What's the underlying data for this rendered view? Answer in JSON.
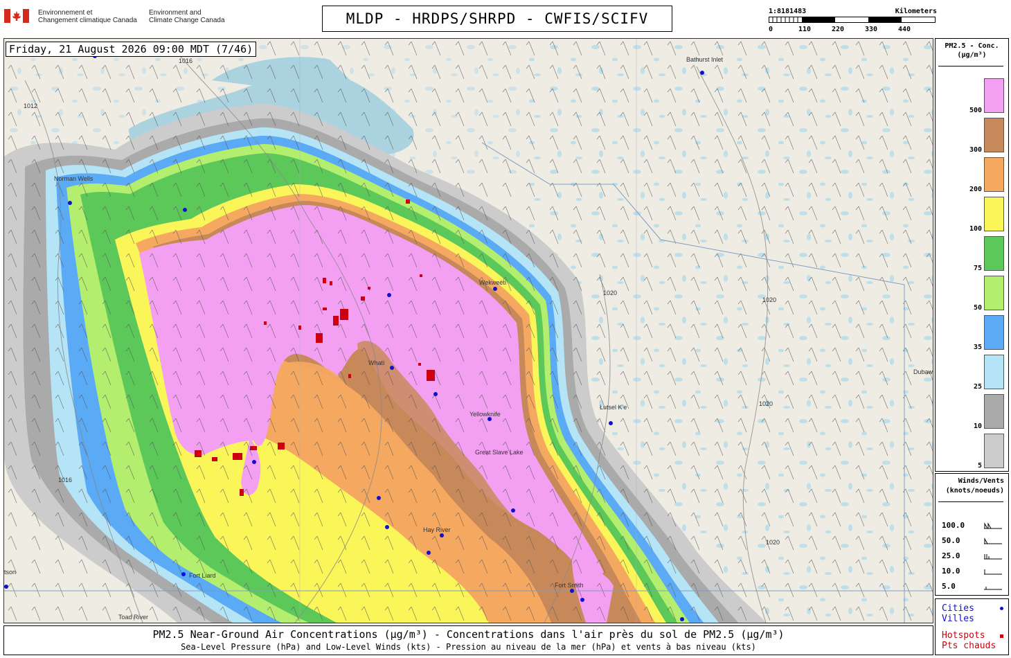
{
  "agency": {
    "fr_line1": "Environnement et",
    "fr_line2": "Changement climatique Canada",
    "en_line1": "Environment and",
    "en_line2": "Climate Change Canada"
  },
  "title": "MLDP - HRDPS/SHRPD - CWFIS/SCIFV",
  "scale": {
    "ratio": "1:8181483",
    "unit": "Kilometers",
    "ticks": [
      "0",
      "110",
      "220",
      "330",
      "440"
    ]
  },
  "timestamp": "Friday, 21 August 2026 09:00 MDT (7/46)",
  "legend": {
    "title_line1": "PM2.5 - Conc.",
    "title_line2": "(µg/m³)",
    "bins": [
      {
        "label": "500",
        "color": "#f3a0f3"
      },
      {
        "label": "300",
        "color": "#c8895a"
      },
      {
        "label": "200",
        "color": "#f5a860"
      },
      {
        "label": "100",
        "color": "#faf65a"
      },
      {
        "label": "75",
        "color": "#5cc85a"
      },
      {
        "label": "50",
        "color": "#b4ee6e"
      },
      {
        "label": "35",
        "color": "#5aaaf5"
      },
      {
        "label": "25",
        "color": "#b4e4f5"
      },
      {
        "label": "10",
        "color": "#aaaaaa"
      },
      {
        "label": "5",
        "color": "#cccccc"
      }
    ]
  },
  "winds_legend": {
    "title_line1": "Winds/Vents",
    "title_line2": "(knots/noeuds)",
    "entries": [
      "100.0",
      "50.0",
      "25.0",
      "10.0",
      "5.0"
    ]
  },
  "key": {
    "cities_line1": "Cities",
    "cities_line2": "Villes",
    "hotspots_line1": "Hotspots",
    "hotspots_line2": "Pts chauds",
    "city_color": "#1010d0",
    "hotspot_color": "#cc0010"
  },
  "footer": {
    "line1": "PM2.5 Near-Ground Air Concentrations (µg/m³) - Concentrations dans l'air près du sol de PM2.5 (µg/m³)",
    "line2": "Sea-Level Pressure (hPa) and Low-Level Winds (kts) - Pression au niveau de la mer (hPa) et vents à bas niveau (kts)"
  },
  "map_labels": {
    "norman_wells": "Norman Wells",
    "bathurst_inlet": "Bathurst Inlet",
    "wekweeti": "Wekweètì",
    "whati": "Whatì",
    "yellowknife": "Yellowknife",
    "great_slave_lake": "Great Slave Lake",
    "lutsel_ke": "Łutsel K'e",
    "hay_river": "Hay River",
    "fort_liard": "Fort Liard",
    "fort_smith": "Fort Smith",
    "toad_river": "Toad River",
    "dubawnt_lake": "Dubawnt Lake",
    "watson": "tson"
  },
  "isobars": [
    "1012",
    "1016",
    "1020"
  ]
}
